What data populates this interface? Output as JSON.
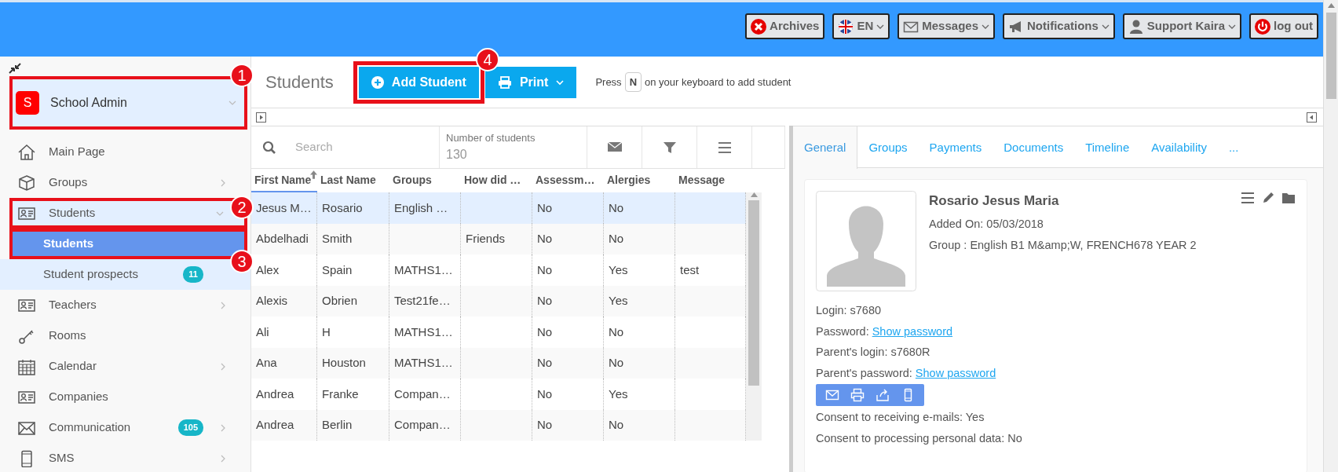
{
  "topbar": {
    "buttons": [
      {
        "label": "Archives",
        "dropdown": false
      },
      {
        "label": "EN",
        "dropdown": true
      },
      {
        "label": "Messages",
        "dropdown": true
      },
      {
        "label": "Notifications",
        "dropdown": true
      },
      {
        "label": "Support Kaira",
        "dropdown": true
      },
      {
        "label": "log out",
        "dropdown": false
      }
    ]
  },
  "sidebar": {
    "header": {
      "initial": "S",
      "label": "School Admin",
      "callout": "1"
    },
    "items": [
      {
        "label": "Main Page"
      },
      {
        "label": "Groups",
        "expanded": false
      },
      {
        "label": "Students",
        "expanded": true,
        "callout": "2",
        "children": [
          {
            "label": "Students",
            "selected": true,
            "callout": "3"
          },
          {
            "label": "Student prospects",
            "selected": false,
            "badge": "11"
          }
        ]
      },
      {
        "label": "Teachers",
        "expanded": false
      },
      {
        "label": "Rooms"
      },
      {
        "label": "Calendar",
        "expanded": false
      },
      {
        "label": "Companies"
      },
      {
        "label": "Communication",
        "expanded": false,
        "badge": "105"
      },
      {
        "label": "SMS",
        "expanded": false
      }
    ]
  },
  "page": {
    "title": "Students",
    "add_button": {
      "label": "Add Student",
      "callout": "4"
    },
    "print_button": {
      "label": "Print"
    },
    "hint": {
      "before": "Press",
      "key": "N",
      "after": "on your keyboard to add student"
    }
  },
  "table": {
    "search_placeholder": "Search",
    "count_label": "Number of students",
    "count": "130",
    "columns": [
      {
        "label": "First Name",
        "sorted": true
      },
      {
        "label": "Last Name",
        "sorted": false
      },
      {
        "label": "Groups",
        "sorted": false
      },
      {
        "label": "How did …",
        "sorted": false
      },
      {
        "label": "Assessm…",
        "sorted": false
      },
      {
        "label": "Alergies",
        "sorted": false
      },
      {
        "label": "Message",
        "sorted": false
      }
    ],
    "rows": [
      {
        "selected": true,
        "cells": [
          "Jesus M…",
          "Rosario",
          "English …",
          null,
          "No",
          "No",
          null
        ]
      },
      {
        "selected": false,
        "cells": [
          "Abdelhadi",
          "Smith",
          null,
          "Friends",
          "No",
          "No",
          null
        ]
      },
      {
        "selected": false,
        "cells": [
          "Alex",
          "Spain",
          "MATHS1…",
          null,
          "No",
          "Yes",
          "test"
        ]
      },
      {
        "selected": false,
        "cells": [
          "Alexis",
          "Obrien",
          "Test21fe…",
          null,
          "No",
          "Yes",
          null
        ]
      },
      {
        "selected": false,
        "cells": [
          "Ali",
          "H",
          "MATHS1…",
          null,
          "No",
          "No",
          null
        ]
      },
      {
        "selected": false,
        "cells": [
          "Ana",
          "Houston",
          "MATHS1…",
          null,
          "No",
          "No",
          null
        ]
      },
      {
        "selected": false,
        "cells": [
          "Andrea",
          "Franke",
          "Compan…",
          null,
          "No",
          "Yes",
          null
        ]
      },
      {
        "selected": false,
        "cells": [
          "Andrea",
          "Berlin",
          "Compan…",
          null,
          "No",
          "No",
          null
        ]
      }
    ]
  },
  "detail": {
    "tabs": [
      {
        "label": "General",
        "selected": true
      },
      {
        "label": "Groups",
        "selected": false
      },
      {
        "label": "Payments",
        "selected": false
      },
      {
        "label": "Documents",
        "selected": false
      },
      {
        "label": "Timeline",
        "selected": false
      },
      {
        "label": "Availability",
        "selected": false
      },
      {
        "label": "...",
        "selected": false
      }
    ],
    "name": "Rosario Jesus Maria",
    "info": [
      "Added On: 05/03/2018",
      "Group : English B1 M&amp;W, FRENCH678 YEAR 2"
    ],
    "fields": [
      {
        "text": "Login: s7680"
      },
      {
        "text": "Password:",
        "link": "Show password"
      },
      {
        "text": "Parent's login: s7680R"
      },
      {
        "text": "Parent's password:",
        "link": "Show password"
      }
    ],
    "consents": [
      "Consent to receiving e-mails: Yes",
      "Consent to processing personal data: No"
    ]
  }
}
